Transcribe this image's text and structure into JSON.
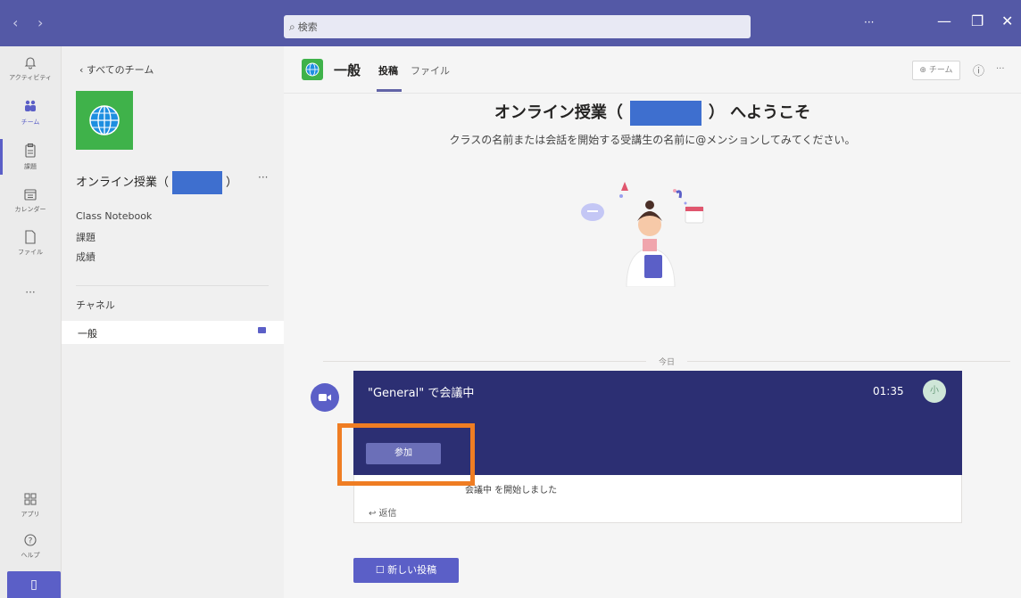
{
  "titlebar": {
    "back_label": "‹",
    "forward_label": "›",
    "search_placeholder": "検索",
    "more_label": "···",
    "minimize_label": "—",
    "maximize_label": "❐",
    "close_label": "✕",
    "bg_color": "#5459a6"
  },
  "rail": {
    "items": [
      {
        "icon": "bell-icon",
        "glyph": "🔔",
        "label": "アクティビティ"
      },
      {
        "icon": "teams-icon",
        "glyph": "👥",
        "label": "チーム"
      },
      {
        "icon": "assignments-icon",
        "glyph": "📋",
        "label": "課題"
      },
      {
        "icon": "calendar-icon",
        "glyph": "📅",
        "label": "カレンダー"
      },
      {
        "icon": "files-icon",
        "glyph": "📄",
        "label": "ファイル"
      },
      {
        "icon": "more-icon",
        "glyph": "···",
        "label": ""
      },
      {
        "icon": "apps-icon",
        "glyph": "⊞",
        "label": "アプリ"
      },
      {
        "icon": "help-icon",
        "glyph": "?",
        "label": "ヘルプ"
      }
    ],
    "active_index": 1
  },
  "team_panel": {
    "back_label": "‹  すべてのチーム",
    "team_name_prefix": "オンライン授業（",
    "team_name_suffix": "）",
    "more_label": "···",
    "menu": [
      "Class Notebook",
      "課題",
      "成績"
    ],
    "section_label": "チャネル",
    "channel_name": "一般"
  },
  "channel": {
    "title": "一般",
    "tabs": [
      "投稿",
      "ファイル"
    ],
    "active_tab": 0,
    "team_button": "チーム",
    "info_label": "ⓘ",
    "more_label": "···"
  },
  "welcome": {
    "title_prefix": "オンライン授業（",
    "title_suffix": "） へようこそ",
    "subtitle": "クラスの名前または会話を開始する受講生の名前に@メンションしてみてください。"
  },
  "feed": {
    "date_label": "今日",
    "call_title": "\"General\" で会議中",
    "call_time": "01:35",
    "join_label": "参加",
    "started_text": "会議中 を開始しました",
    "reply_label": "↩ 返信",
    "new_post_label": "新しい投稿",
    "card_color": "#2c2f73",
    "accent_color": "#5b5fc7",
    "highlight_color": "#ef7d23"
  }
}
